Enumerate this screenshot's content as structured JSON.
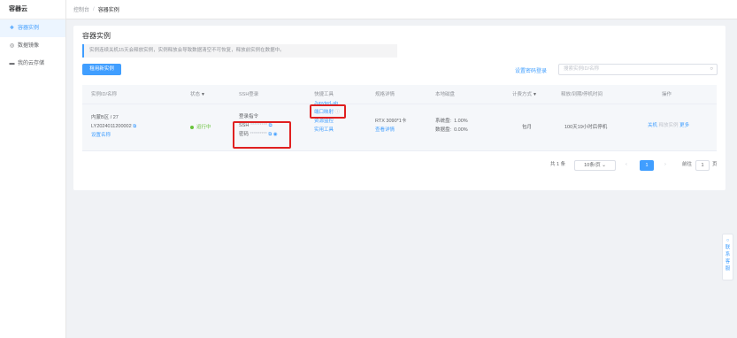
{
  "app": {
    "brand": "容器云"
  },
  "sidebar": {
    "items": [
      {
        "label": "容器实例",
        "icon": "container-icon"
      },
      {
        "label": "数据镜像",
        "icon": "image-icon"
      },
      {
        "label": "我的云存储",
        "icon": "storage-icon"
      }
    ]
  },
  "breadcrumb": {
    "home": "控制台",
    "sep": "/",
    "current": "容器实例"
  },
  "page": {
    "title": "容器实例",
    "notice": "实例连续关机15天会释放实例，实例释放会导致数据清空不可恢复，释放前实例在数据中。",
    "rent_button": "租用新实例",
    "set_password_link": "设置密码登录",
    "search_placeholder": "搜索实例ID/名称"
  },
  "table": {
    "headers": {
      "instance": "实例ID/名称",
      "status": "状态",
      "ssh": "SSH登录",
      "tools": "快捷工具",
      "spec": "规格详情",
      "disk": "本地磁盘",
      "billing": "计费方式",
      "release": "释放/到期/停机时间",
      "ops": "操作"
    },
    "row": {
      "region": "内蒙B区 / 27",
      "instance_id": "LY2024011200002",
      "set_name": "设置名称",
      "status": "运行中",
      "login_cmd_label": "登录指令",
      "ssh_label": "SSH",
      "ssh_masked": "*********",
      "pwd_label": "密码",
      "pwd_masked": "*********",
      "tool_jupyter": "JupyterLab",
      "tool_port": "端口映射",
      "tool_monitor": "资源监控",
      "tool_utility": "实用工具",
      "gpu": "RTX 3090*1卡",
      "spec_detail": "查看详情",
      "sys_disk_label": "系统盘:",
      "sys_disk_value": "1.00%",
      "data_disk_label": "数据盘:",
      "data_disk_value": "0.00%",
      "billing": "包月",
      "release_time": "100天19小时后停机",
      "op_shutdown": "关机",
      "op_more_disabled": "释放实例",
      "op_more": "更多"
    }
  },
  "pagination": {
    "total": "共 1 条",
    "page_size": "10条/页",
    "prev": "‹",
    "current_page": "1",
    "next": "›",
    "goto_label": "前往",
    "goto_value": "1",
    "page_suffix": "页"
  },
  "float_contact": "联系客服",
  "colors": {
    "primary": "#409eff",
    "success": "#67c23a",
    "highlight": "#e02020"
  }
}
